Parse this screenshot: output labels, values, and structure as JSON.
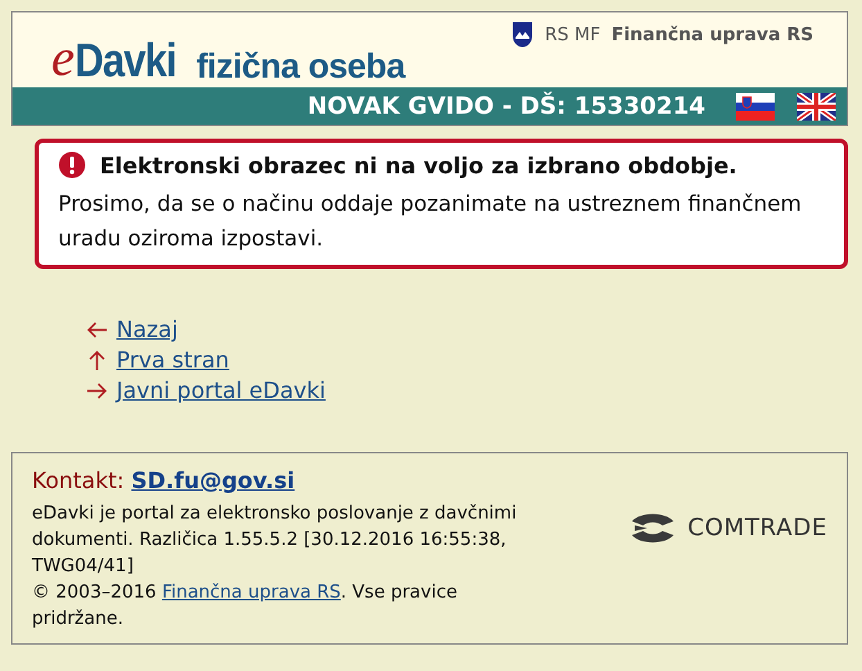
{
  "header": {
    "logo_prefix": "e",
    "logo_name": "Davki",
    "subtitle": "fizična oseba",
    "ministry": "RS MF",
    "agency": "Finančna uprava RS",
    "user": "NOVAK GVIDO - DŠ: 15330214",
    "languages": [
      {
        "kind": "si"
      },
      {
        "kind": "uk"
      }
    ]
  },
  "error": {
    "title": "Elektronski obrazec ni na voljo za izbrano obdobje.",
    "message": "Prosimo, da se o načinu oddaje pozanimate na ustreznem finančnem uradu oziroma izpostavi."
  },
  "links": [
    {
      "kind": "back",
      "label": "Nazaj"
    },
    {
      "kind": "up",
      "label": "Prva stran"
    },
    {
      "kind": "forward",
      "label": "Javni portal eDavki"
    }
  ],
  "footer": {
    "contact_label": "Kontakt:",
    "contact_email": "SD.fu@gov.si",
    "about": "eDavki je portal za elektronsko poslovanje z davčnimi dokumenti. Različica 1.55.5.2 [30.12.2016 16:55:38, TWG04/41]",
    "copyright": "© 2003–2016",
    "copyright_link": "Finančna uprava RS",
    "copyright_rest": ". Vse pravice pridržane.",
    "vendor": "COMTRADE"
  }
}
